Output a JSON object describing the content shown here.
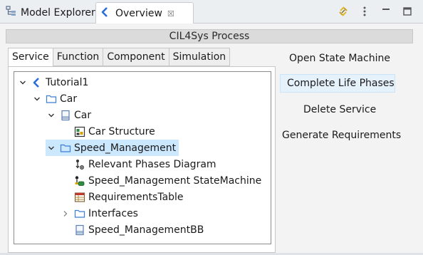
{
  "tabs": {
    "model_explorer": {
      "label": "Model Explorer",
      "icon": "model-explorer-icon"
    },
    "overview": {
      "label": "Overview",
      "icon": "overview-icon",
      "close": "☒"
    }
  },
  "toolbar": {
    "icons": [
      "link-refresh-icon",
      "view-menu-icon",
      "minimize-icon",
      "maximize-icon"
    ]
  },
  "form": {
    "title": "CIL4Sys Process"
  },
  "content_tabs": [
    "Service",
    "Function",
    "Component",
    "Simulation"
  ],
  "tree": {
    "items": [
      {
        "label": "Tutorial1",
        "icon": "project-icon",
        "twisty": "expanded",
        "level": 0
      },
      {
        "label": "Car",
        "icon": "folder-icon",
        "twisty": "expanded",
        "level": 1
      },
      {
        "label": "Car",
        "icon": "block-icon",
        "twisty": "expanded",
        "level": 2
      },
      {
        "label": "Car Structure",
        "icon": "structure-diagram-icon",
        "twisty": "none",
        "level": 3
      },
      {
        "label": "Speed_Management",
        "icon": "folder-icon",
        "twisty": "expanded",
        "level": 2,
        "selected": true
      },
      {
        "label": "Relevant Phases Diagram",
        "icon": "phases-diagram-icon",
        "twisty": "none",
        "level": 3
      },
      {
        "label": "Speed_Management StateMachine",
        "icon": "state-machine-icon",
        "twisty": "none",
        "level": 3
      },
      {
        "label": "RequirementsTable",
        "icon": "table-icon",
        "twisty": "none",
        "level": 3
      },
      {
        "label": "Interfaces",
        "icon": "folder-icon",
        "twisty": "collapsed",
        "level": 3
      },
      {
        "label": "Speed_ManagementBB",
        "icon": "block-icon",
        "twisty": "none",
        "level": 3
      }
    ]
  },
  "actions": {
    "open_state_machine": "Open State Machine",
    "complete_life_phases": "Complete Life Phases",
    "delete_service": "Delete Service",
    "generate_requirements": "Generate Requirements"
  },
  "colors": {
    "selection": "#cce8ff",
    "accent": "#2a6fd6",
    "folder": "#3b7dd8"
  }
}
